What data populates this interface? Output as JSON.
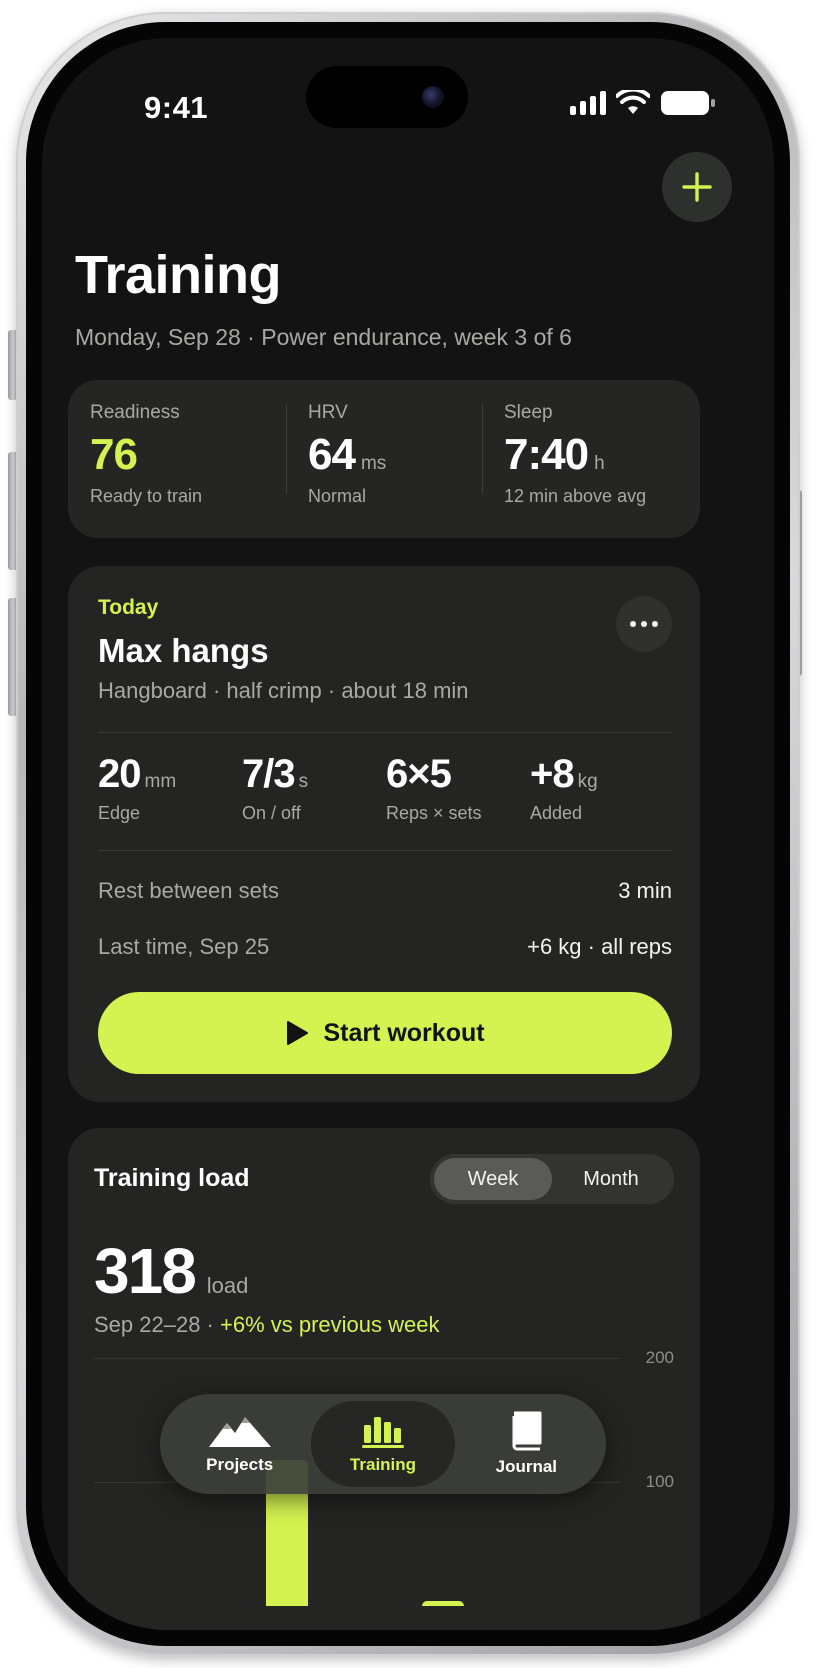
{
  "status_bar": {
    "time": "9:41"
  },
  "header": {
    "title": "Training",
    "subtitle": "Monday, Sep 28 · Power endurance, week 3 of 6",
    "add_icon": "plus-icon"
  },
  "metrics": [
    {
      "label": "Readiness",
      "value": "76",
      "unit": "",
      "note": "Ready to train"
    },
    {
      "label": "HRV",
      "value": "64",
      "unit": "ms",
      "note": "Normal"
    },
    {
      "label": "Sleep",
      "value": "7:40",
      "unit": "h",
      "note": "12 min above avg"
    }
  ],
  "workout": {
    "tag": "Today",
    "title": "Max hangs",
    "description": "Hangboard · half crimp · about 18 min",
    "stats": [
      {
        "value": "20",
        "unit": "mm",
        "label": "Edge"
      },
      {
        "value": "7/3",
        "unit": "s",
        "label": "On / off"
      },
      {
        "value": "6×5",
        "unit": "",
        "label": "Reps × sets"
      },
      {
        "value": "+8",
        "unit": "kg",
        "label": "Added"
      }
    ],
    "rest_label": "Rest between sets",
    "rest_value": "3 min",
    "last_label": "Last time, Sep 25",
    "last_value": "+6 kg · all reps",
    "start_label": "Start workout"
  },
  "load": {
    "title": "Training load",
    "segments": [
      "Week",
      "Month"
    ],
    "active_segment": "Week",
    "value": "318",
    "unit": "load",
    "range": "Sep 22–28 · ",
    "change": "+6% vs previous week",
    "axis_top": "200",
    "axis_mid": "100"
  },
  "chart_data": {
    "type": "bar",
    "categories": [],
    "values": [
      118,
      4
    ],
    "ylim": [
      0,
      200
    ],
    "yticks": [
      "200",
      "100"
    ]
  },
  "tab_bar": {
    "tabs": [
      {
        "label": "Projects",
        "icon": "mountains-icon"
      },
      {
        "label": "Training",
        "icon": "bar-chart-icon"
      },
      {
        "label": "Journal",
        "icon": "book-icon"
      }
    ],
    "active": "Training"
  },
  "colors": {
    "accent": "#d4f250",
    "background": "#121312",
    "card": "#242523"
  }
}
